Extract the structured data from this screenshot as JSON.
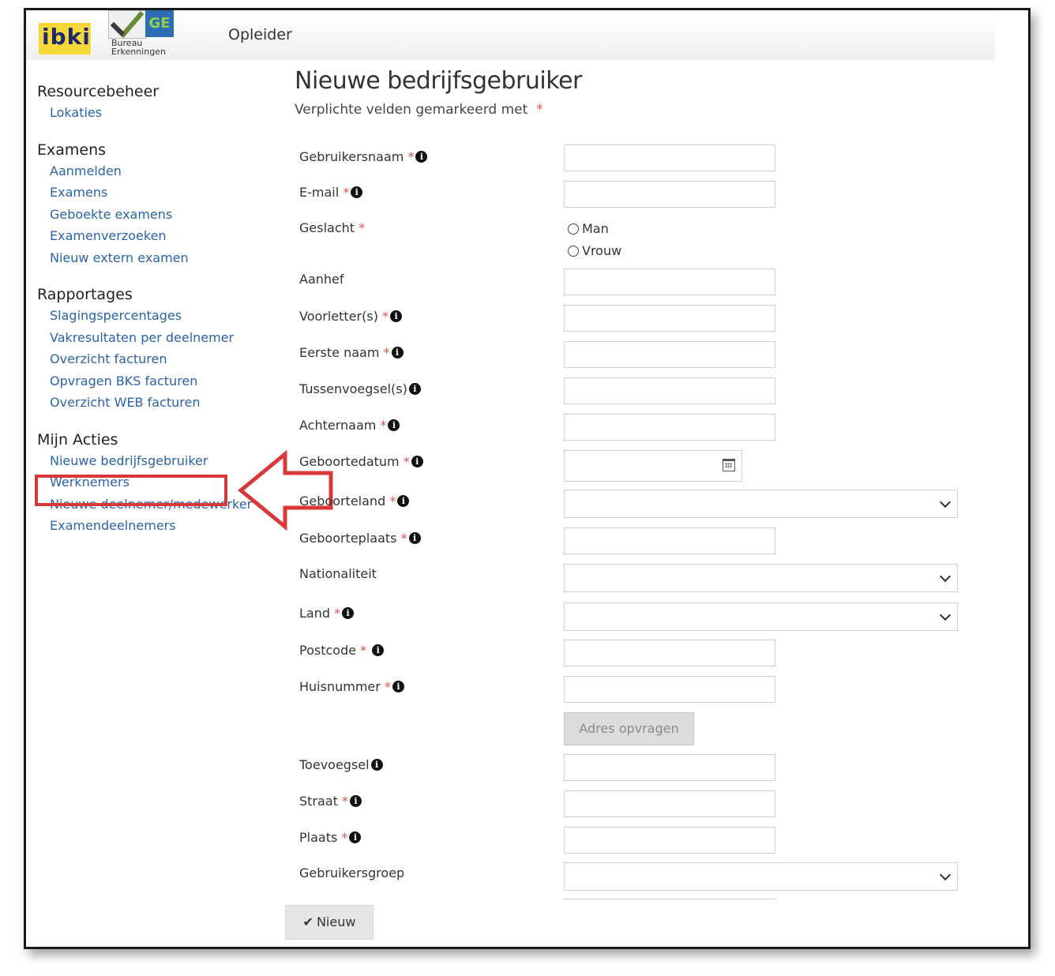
{
  "header": {
    "logo_text": "ibki",
    "logo2_badge": "GE",
    "logo2_line1": "Bureau",
    "logo2_line2": "Erkenningen",
    "role": "Opleider"
  },
  "sidebar": {
    "groups": [
      {
        "title": "Resourcebeheer",
        "items": [
          "Lokaties"
        ]
      },
      {
        "title": "Examens",
        "items": [
          "Aanmelden",
          "Examens",
          "Geboekte examens",
          "Examenverzoeken",
          "Nieuw extern examen"
        ]
      },
      {
        "title": "Rapportages",
        "items": [
          "Slagingspercentages",
          "Vakresultaten per deelnemer",
          "Overzicht facturen",
          "Opvragen BKS facturen",
          "Overzicht WEB facturen"
        ]
      },
      {
        "title": "Mijn Acties",
        "items": [
          "Nieuwe bedrijfsgebruiker",
          "Werknemers",
          "Nieuwe deelnemer/medewerker",
          "Examendeelnemers"
        ]
      }
    ]
  },
  "main": {
    "title": "Nieuwe bedrijfsgebruiker",
    "subtitle": "Verplichte velden gemarkeerd met",
    "required_mark": "*",
    "info_glyph": "i",
    "fields": {
      "gebruikersnaam": "Gebruikersnaam",
      "email": "E-mail",
      "geslacht": "Geslacht",
      "aanhef": "Aanhef",
      "voorletters": "Voorletter(s)",
      "eerste_naam": "Eerste naam",
      "tussenvoegsels": "Tussenvoegsel(s)",
      "achternaam": "Achternaam",
      "geboortedatum": "Geboortedatum",
      "geboorteland": "Geboorteland",
      "geboorteplaats": "Geboorteplaats",
      "nationaliteit": "Nationaliteit",
      "land": "Land",
      "postcode": "Postcode",
      "huisnummer": "Huisnummer",
      "toevoegsel": "Toevoegsel",
      "straat": "Straat",
      "plaats": "Plaats",
      "gebruikersgroep": "Gebruikersgroep"
    },
    "gender_options": [
      "Man",
      "Vrouw"
    ],
    "adres_button": "Adres opvragen",
    "submit_button": "Nieuw",
    "submit_icon": "✔"
  },
  "colors": {
    "link": "#2b63a8",
    "required": "#d9534f",
    "annotation": "#d93838"
  }
}
